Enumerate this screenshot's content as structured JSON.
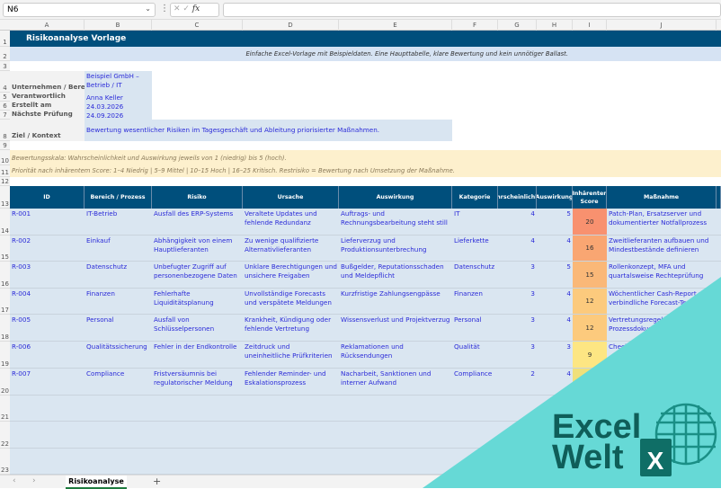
{
  "formula_bar": {
    "name_box": "N6",
    "fx": "fx",
    "cancel": "✕",
    "confirm": "✓",
    "value": ""
  },
  "columns": [
    "A",
    "B",
    "C",
    "D",
    "E",
    "F",
    "G",
    "H",
    "I",
    "J"
  ],
  "rows": [
    "1",
    "2",
    "3",
    "4",
    "5",
    "6",
    "7",
    "8",
    "9",
    "10",
    "11",
    "12",
    "13",
    "14",
    "15",
    "16",
    "17",
    "18",
    "19",
    "20",
    "21",
    "22",
    "23"
  ],
  "title": "Risikoanalyse Vorlage",
  "subtitle": "Einfache Excel-Vorlage mit Beispieldaten. Eine Haupttabelle, klare Bewertung und kein unnötiger Ballast.",
  "info": [
    {
      "label": "Unternehmen / Bereich",
      "value": "Beispiel GmbH – Betrieb / IT"
    },
    {
      "label": "Verantwortlich",
      "value": "Anna Keller"
    },
    {
      "label": "Erstellt am",
      "value": "24.03.2026"
    },
    {
      "label": "Nächste Prüfung",
      "value": "24.09.2026"
    },
    {
      "label": "Ziel / Kontext",
      "value": "Bewertung wesentlicher Risiken im Tagesgeschäft und Ableitung priorisierter Maßnahmen."
    }
  ],
  "notes": [
    "Bewertungsskala: Wahrscheinlichkeit und Auswirkung jeweils von 1 (niedrig) bis 5 (hoch).",
    "Priorität nach inhärentem Score: 1–4 Niedrig | 5–9 Mittel | 10–15 Hoch | 16–25 Kritisch. Restrisiko = Bewertung nach Umsetzung der Maßnahme."
  ],
  "table": {
    "headers": [
      "ID",
      "Bereich / Prozess",
      "Risiko",
      "Ursache",
      "Auswirkung",
      "Kategorie",
      "Wahrscheinlichkeit",
      "Auswirkung",
      "Inhärenter Score",
      "Maßnahme"
    ],
    "rows": [
      [
        "R-001",
        "IT-Betrieb",
        "Ausfall des ERP-Systems",
        "Veraltete Updates und fehlende Redundanz",
        "Auftrags- und Rechnungsbearbeitung steht still",
        "IT",
        "4",
        "5",
        "20",
        "Patch-Plan, Ersatzserver und dokumentierter Notfallprozess"
      ],
      [
        "R-002",
        "Einkauf",
        "Abhängigkeit von einem Hauptlieferanten",
        "Zu wenige qualifizierte Alternativlieferanten",
        "Lieferverzug und Produktionsunterbrechung",
        "Lieferkette",
        "4",
        "4",
        "16",
        "Zweitlieferanten aufbauen und Mindestbestände definieren"
      ],
      [
        "R-003",
        "Datenschutz",
        "Unbefugter Zugriff auf personenbezogene Daten",
        "Unklare Berechtigungen und unsichere Freigaben",
        "Bußgelder, Reputationsschaden und Meldepflicht",
        "Datenschutz",
        "3",
        "5",
        "15",
        "Rollenkonzept, MFA und quartalsweise Rechteprüfung"
      ],
      [
        "R-004",
        "Finanzen",
        "Fehlerhafte Liquiditätsplanung",
        "Unvollständige Forecasts und verspätete Meldungen",
        "Kurzfristige Zahlungsengpässe",
        "Finanzen",
        "3",
        "4",
        "12",
        "Wöchentlicher Cash-Report und verbindliche Forecast-Termine"
      ],
      [
        "R-005",
        "Personal",
        "Ausfall von Schlüsselpersonen",
        "Krankheit, Kündigung oder fehlende Vertretung",
        "Wissensverlust und Projektverzug",
        "Personal",
        "3",
        "4",
        "12",
        "Vertretungsregelung und Prozessdokumentation"
      ],
      [
        "R-006",
        "Qualitätssicherung",
        "Fehler in der Endkontrolle",
        "Zeitdruck und uneinheitliche Prüfkriterien",
        "Reklamationen und Rücksendungen",
        "Qualität",
        "3",
        "3",
        "9",
        "Checkliste und Stichproben"
      ],
      [
        "R-007",
        "Compliance",
        "Fristversäumnis bei regulatorischer Meldung",
        "Fehlender Reminder- und Eskalationsprozess",
        "Nacharbeit, Sanktionen und interner Aufwand",
        "Compliance",
        "2",
        "4",
        "",
        ""
      ]
    ]
  },
  "score_colors": {
    "20": "#f8916f",
    "16": "#f9a672",
    "15": "#fab878",
    "12": "#fcca7d",
    "9": "#fde683",
    "": "#f0e07a"
  },
  "sheet_tab": "Risikoanalyse",
  "add_sheet": "+",
  "logo": {
    "line1": "Excel",
    "line2": "Welt",
    "badge": "X",
    "color": "#0f5e59",
    "bg": "#66d9d6"
  }
}
